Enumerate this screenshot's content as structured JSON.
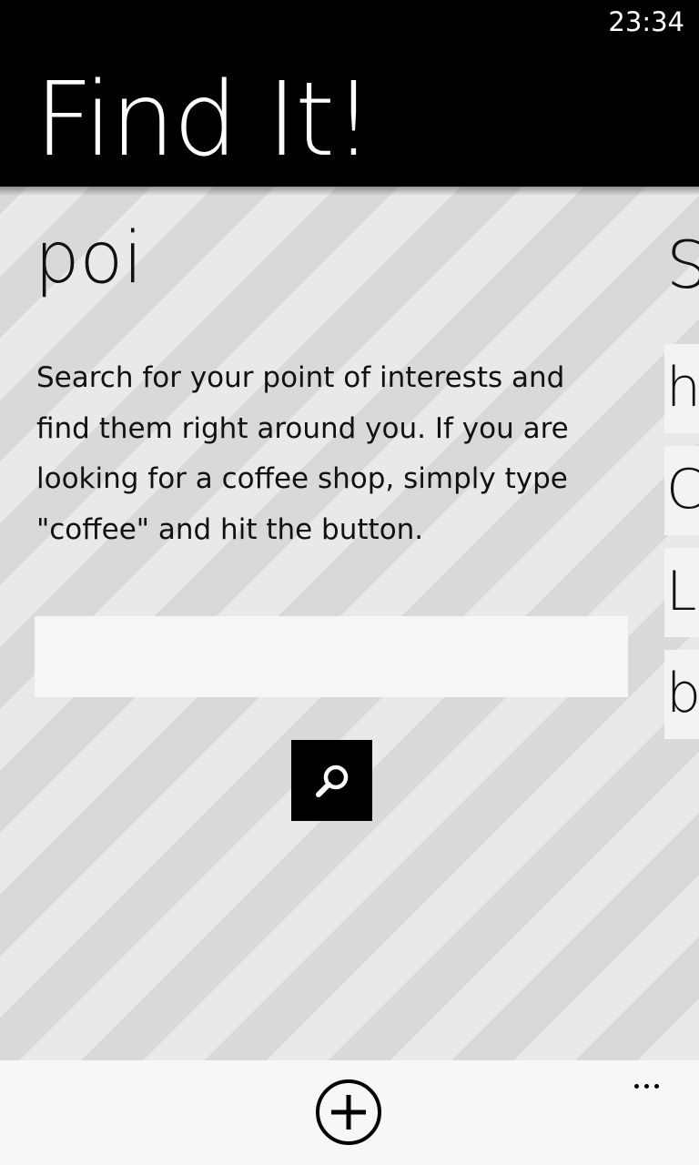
{
  "status_bar": {
    "time": "23:34"
  },
  "header": {
    "title": "Find It!"
  },
  "pivot": {
    "title": "poi",
    "description": "Search for your point of interests and find them right around you. If you are looking for a coffee shop, simply type \"coffee\" and hit the button.",
    "search": {
      "value": "",
      "placeholder": ""
    },
    "search_button_icon": "search-icon"
  },
  "next_pivot_peek": {
    "title_fragment": "S",
    "items": [
      "h",
      "C",
      "Lo",
      "b"
    ]
  },
  "app_bar": {
    "add_icon": "add-circle-icon",
    "more_icon": "ellipsis-icon"
  },
  "colors": {
    "header_bg": "#000000",
    "stripe_light": "#e9e9e9",
    "stripe_dark": "#d9d9d9",
    "input_bg": "#f6f6f6",
    "app_bar_bg": "#f7f7f7"
  }
}
